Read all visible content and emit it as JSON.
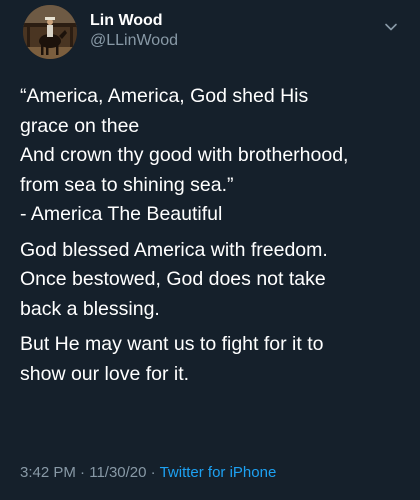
{
  "author": {
    "name": "Lin Wood",
    "handle": "@LLinWood"
  },
  "icons": {
    "avatar": "profile-photo-horse-rider",
    "menu": "chevron-down-icon"
  },
  "tweet": {
    "paragraphs": [
      [
        "“America, America, God shed His",
        "grace on thee",
        "And crown thy good with brotherhood,",
        "from sea to shining sea.”",
        "- America The Beautiful"
      ],
      [
        "God blessed America with freedom.",
        "Once bestowed, God does not take",
        "back a blessing."
      ],
      [
        "But He may want us to fight for it to",
        "show our love for it."
      ]
    ]
  },
  "meta": {
    "time": "3:42 PM",
    "separator": " · ",
    "date": "11/30/20",
    "source": "Twitter for iPhone"
  },
  "colors": {
    "background": "#15202b",
    "text": "#ffffff",
    "secondary": "#8899a6",
    "link": "#1da1f2"
  }
}
